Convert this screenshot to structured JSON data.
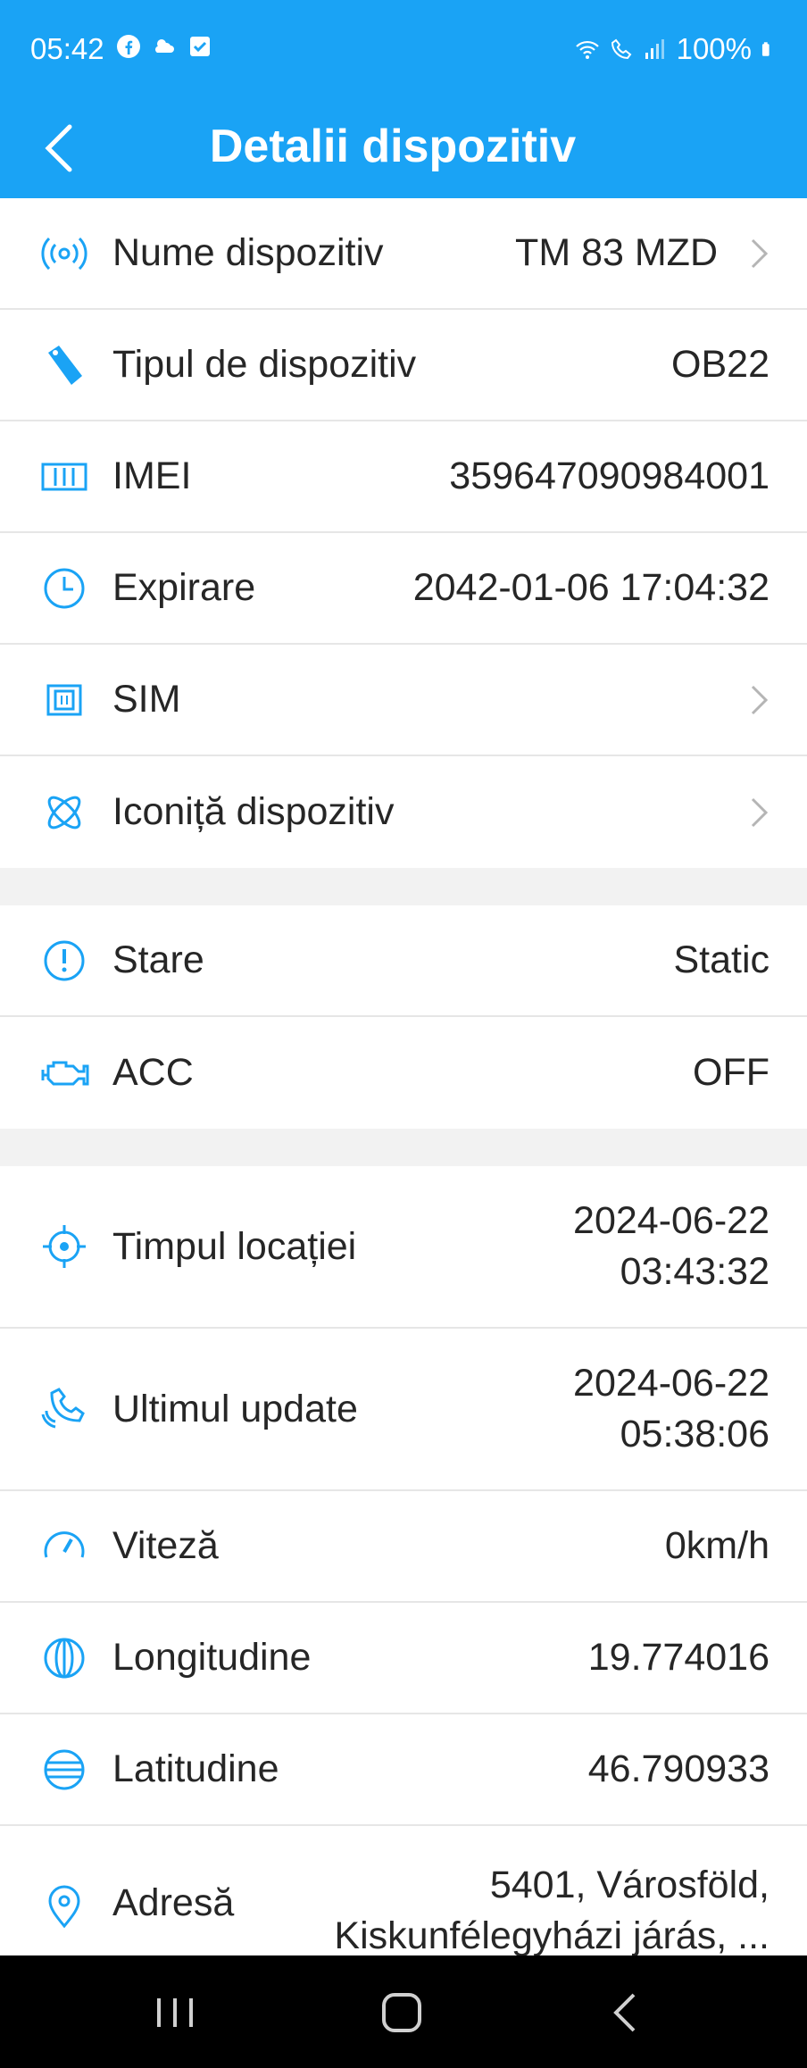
{
  "status_bar": {
    "time": "05:42",
    "battery": "100%",
    "left_icons": [
      "facebook-icon",
      "weather-icon",
      "check-box-icon"
    ],
    "right_icons": [
      "wifi-icon",
      "wifi-call-icon",
      "signal-icon",
      "battery-icon"
    ]
  },
  "app_bar": {
    "title": "Detalii dispozitiv",
    "back_icon": "back-arrow-icon"
  },
  "colors": {
    "accent": "#1aa3f5",
    "icon": "#1aa3f5",
    "text": "#262626",
    "divider": "#e6e6e6",
    "section_bg": "#f2f2f2"
  },
  "section1": {
    "rows": [
      {
        "label": "Nume dispozitiv",
        "value": "TM 83 MZD",
        "icon": "antenna-icon"
      },
      {
        "label": "Tipul de dispozitiv",
        "value": "OB22",
        "icon": "tag-icon"
      },
      {
        "label": "IMEI",
        "value": "359647090984001",
        "icon": "barcode-icon"
      },
      {
        "label": "Expirare",
        "value": "2042-01-06 17:04:32",
        "icon": "clock-icon"
      },
      {
        "label": "SIM",
        "value": "",
        "icon": "sim-card-icon"
      },
      {
        "label": "Iconiță dispozitiv",
        "value": "",
        "icon": "atom-icon"
      }
    ]
  },
  "section2": {
    "rows": [
      {
        "label": "Stare",
        "value": "Static",
        "icon": "alert-circle-icon"
      },
      {
        "label": "ACC",
        "value": "OFF",
        "icon": "engine-icon"
      }
    ]
  },
  "section3": {
    "rows": [
      {
        "label": "Timpul locației",
        "value_line1": "2024-06-22",
        "value_line2": "03:43:32",
        "icon": "crosshair-icon"
      },
      {
        "label": "Ultimul update",
        "value_line1": "2024-06-22",
        "value_line2": "05:38:06",
        "icon": "signal-wave-icon"
      },
      {
        "label": "Viteză",
        "value": "0km/h",
        "icon": "speedometer-icon"
      },
      {
        "label": "Longitudine",
        "value": "19.774016",
        "icon": "longitude-globe-icon"
      },
      {
        "label": "Latitudine",
        "value": "46.790933",
        "icon": "latitude-globe-icon"
      },
      {
        "label": "Adresă",
        "value_line1": "5401, Városföld,",
        "value_line2": "Kiskunfélegyházi járás, ...",
        "icon": "map-pin-icon"
      }
    ]
  },
  "nav_bar": {
    "buttons": [
      "recent-apps-icon",
      "home-icon",
      "back-icon"
    ]
  }
}
